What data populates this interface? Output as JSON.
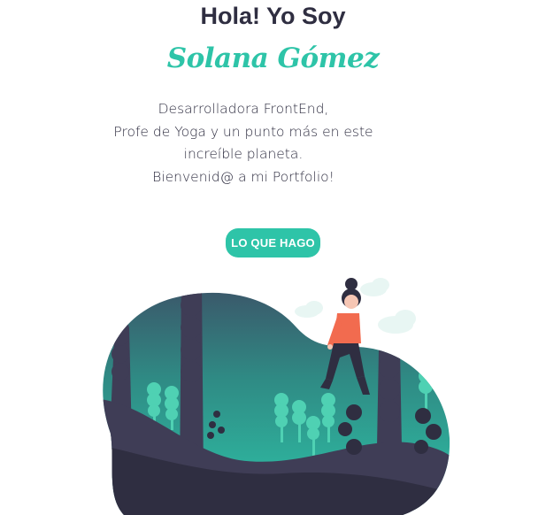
{
  "hero": {
    "greeting": "Hola! Yo Soy",
    "name": "Solana Gómez",
    "intro_lines": [
      "Desarrolladora FrontEnd,",
      "Profe de Yoga y un punto más en este",
      "increíble planeta.",
      "Bienvenid@ a mi Portfolio!"
    ],
    "cta_label": "LO QUE HAGO"
  },
  "illustration": {
    "icon": "yoga-forest-illustration"
  },
  "colors": {
    "accent": "#2ec4a8",
    "text": "#2f2e41",
    "forest_dark": "#3f3d56",
    "shirt": "#f26b4f"
  }
}
